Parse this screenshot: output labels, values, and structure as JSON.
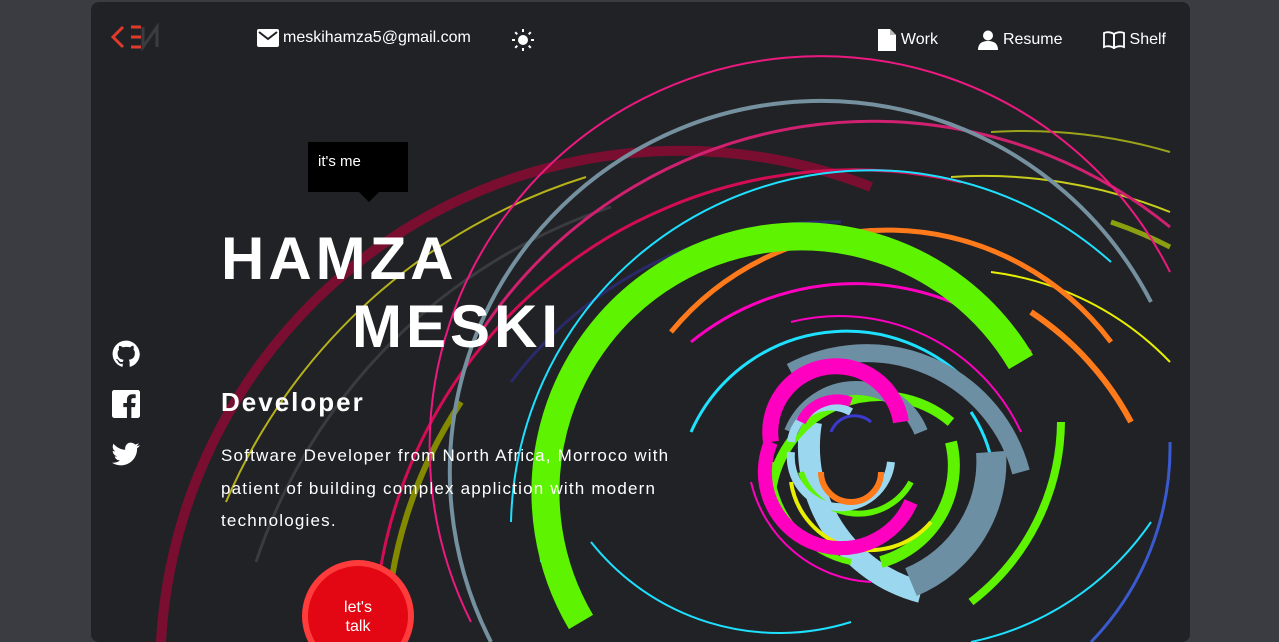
{
  "header": {
    "logo_text": "EN",
    "email": "meskihamza5@gmail.com",
    "theme_toggle_icon": "sun-icon",
    "nav": [
      {
        "label": "Work",
        "icon": "document-icon"
      },
      {
        "label": "Resume",
        "icon": "user-icon"
      },
      {
        "label": "Shelf",
        "icon": "book-icon"
      }
    ]
  },
  "social": [
    {
      "name": "github",
      "icon": "github-icon"
    },
    {
      "name": "facebook",
      "icon": "facebook-icon"
    },
    {
      "name": "twitter",
      "icon": "twitter-icon"
    }
  ],
  "hero": {
    "tooltip": "it's me",
    "first_name": "HAMZA",
    "last_name": "MESKI",
    "role": "Developer",
    "bio": "Software Developer from North Africa, Morroco with patient of building complex appliction with modern technologies.",
    "cta": "let's talk"
  },
  "colors": {
    "page_bg": "#3a3c41",
    "card_bg": "#212226",
    "accent_red": "#e30613",
    "logo_red": "#e03a2b"
  }
}
